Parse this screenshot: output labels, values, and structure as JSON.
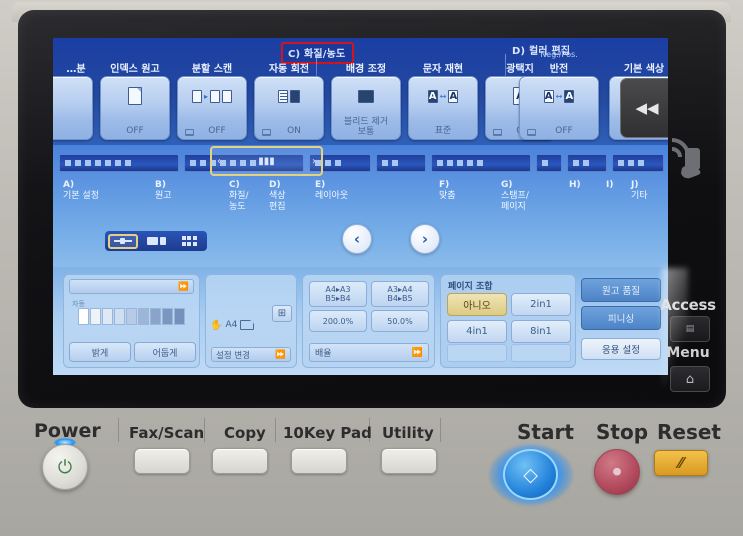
{
  "screen": {
    "sections": [
      {
        "key": "C)",
        "title": "화질/농도",
        "highlighted": true
      },
      {
        "key": "D)",
        "title": "컬러 편집",
        "highlighted": false
      }
    ],
    "tiles": [
      {
        "label": "…분",
        "state": "",
        "sub": "",
        "partial": true
      },
      {
        "label": "인덱스 원고",
        "state": "OFF",
        "sub": ""
      },
      {
        "label": "분할 스캔",
        "state": "OFF",
        "sub": ""
      },
      {
        "label": "자동 회전",
        "state": "ON",
        "sub": ""
      },
      {
        "label": "배경 조정",
        "state": "블리드 제거",
        "state2": "보통",
        "sub": ""
      },
      {
        "label": "문자 재현",
        "state": "표준",
        "sub": ""
      },
      {
        "label": "광택지",
        "state": "OFF",
        "sub": ""
      },
      {
        "label": "반전",
        "state": "OFF",
        "sub": "Neg./Pos."
      },
      {
        "label": "기본 색상",
        "state": "",
        "sub": ""
      }
    ],
    "last_tile_icon": "rewind-icon",
    "strip_selector": {
      "prev": "‹",
      "mid": "▮▮▮",
      "next": "›"
    },
    "legend": [
      {
        "key": "A)",
        "text": "기본 설정"
      },
      {
        "key": "B)",
        "text": "원고"
      },
      {
        "key": "C)",
        "text": "화질/",
        "text2": "농도"
      },
      {
        "key": "D)",
        "text": "색상",
        "text2": "편집"
      },
      {
        "key": "E)",
        "text": "레이아웃"
      },
      {
        "key": "F)",
        "text": "맞춤"
      },
      {
        "key": "G)",
        "text": "스탬프/",
        "text2": "페이지"
      },
      {
        "key": "H)",
        "text": ""
      },
      {
        "key": "I)",
        "text": ""
      },
      {
        "key": "J)",
        "text": "기타"
      }
    ],
    "view_modes": [
      {
        "name": "slider-view",
        "selected": true
      },
      {
        "name": "card-view",
        "selected": false
      },
      {
        "name": "grid-view",
        "selected": false
      }
    ],
    "pager": {
      "prev": "‹",
      "next": "›"
    },
    "confirm": {
      "icon": "check-icon",
      "label": "✔"
    },
    "bottom": {
      "density": {
        "top_bar": "",
        "top_bar_arrow": "⏩",
        "scale_label": "자동",
        "steps": 9,
        "selected_step": 4,
        "lighter": "밝게",
        "darker": "어둡게"
      },
      "paper": {
        "size": "A4",
        "hand_icon": "hand-icon",
        "paper_icon": "paper-icon",
        "plus": "⊞",
        "change": "설정 변경",
        "change_arrow": "⏩"
      },
      "zoom": {
        "buttons": [
          {
            "line1": "A4▸A3",
            "line2": "B5▸B4"
          },
          {
            "line1": "A3▸A4",
            "line2": "B4▸B5"
          },
          {
            "line1": "200.0%",
            "line2": ""
          },
          {
            "line1": "50.0%",
            "line2": ""
          }
        ],
        "arrange": "배율",
        "arrange_arrow": "⏩"
      },
      "combine": {
        "title": "페이지 조합",
        "options": [
          {
            "label": "아니오",
            "selected": true
          },
          {
            "label": "2in1",
            "selected": false
          },
          {
            "label": "4in1",
            "selected": false
          },
          {
            "label": "8in1",
            "selected": false
          }
        ]
      },
      "right_buttons": [
        {
          "label": "원고 품질"
        },
        {
          "label": "피니싱"
        },
        {
          "label": "응용 설정"
        }
      ]
    }
  },
  "device": {
    "nfc_icon": "nfc-card-reader-icon",
    "access_label": "Access",
    "access_icon": "id-card-icon",
    "menu_label": "Menu",
    "menu_icon": "home-icon",
    "keys": {
      "power": "Power",
      "power_icon": "power-icon",
      "fax_scan": "Fax/Scan",
      "copy": "Copy",
      "tenkey": "10Key Pad",
      "utility": "Utility",
      "start": "Start",
      "start_icon": "diamond-icon",
      "stop": "Stop",
      "stop_icon": "stop-icon",
      "reset": "Reset",
      "reset_icon": "slash-icon"
    }
  },
  "colors": {
    "screen_blue": "#2a56c4",
    "highlight_red": "#d4141b",
    "selected_gold": "#ddcb84",
    "start_blue": "#1f7fd8",
    "stop_red": "#b14a5c",
    "reset_amber": "#d99a21"
  }
}
